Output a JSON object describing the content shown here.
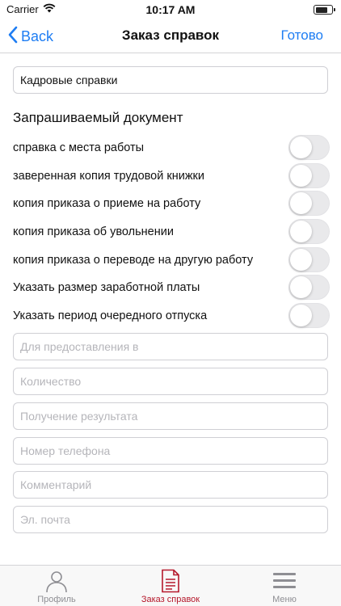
{
  "status_bar": {
    "carrier": "Carrier",
    "time": "10:17 AM",
    "battery_level": 0.8
  },
  "nav": {
    "back_label": "Back",
    "title": "Заказ справок",
    "done_label": "Готово"
  },
  "form": {
    "certificate_type": "Кадровые справки",
    "section_title": "Запрашиваемый документ",
    "toggles": [
      {
        "label": "справка с места работы",
        "on": false
      },
      {
        "label": "заверенная копия трудовой книжки",
        "on": false
      },
      {
        "label": "копия приказа о приеме на работу",
        "on": false
      },
      {
        "label": "копия приказа об увольнении",
        "on": false
      },
      {
        "label": "копия приказа о переводе на другую работу",
        "on": false
      },
      {
        "label": "Указать размер заработной платы",
        "on": false
      },
      {
        "label": "Указать период очередного отпуска",
        "on": false
      }
    ],
    "fields": [
      {
        "placeholder": "Для предоставления в",
        "value": ""
      },
      {
        "placeholder": "Количество",
        "value": ""
      },
      {
        "placeholder": "Получение результата",
        "value": ""
      },
      {
        "placeholder": "Номер телефона",
        "value": ""
      },
      {
        "placeholder": "Комментарий",
        "value": ""
      },
      {
        "placeholder": "Эл. почта",
        "value": ""
      }
    ]
  },
  "tabs": [
    {
      "label": "Профиль",
      "icon": "person-icon",
      "active": false
    },
    {
      "label": "Заказ справок",
      "icon": "document-icon",
      "active": true
    },
    {
      "label": "Меню",
      "icon": "menu-icon",
      "active": false
    }
  ],
  "colors": {
    "accent": "#1e7df3",
    "active_tab": "#b5192c",
    "inactive_tab": "#8e8e93"
  }
}
